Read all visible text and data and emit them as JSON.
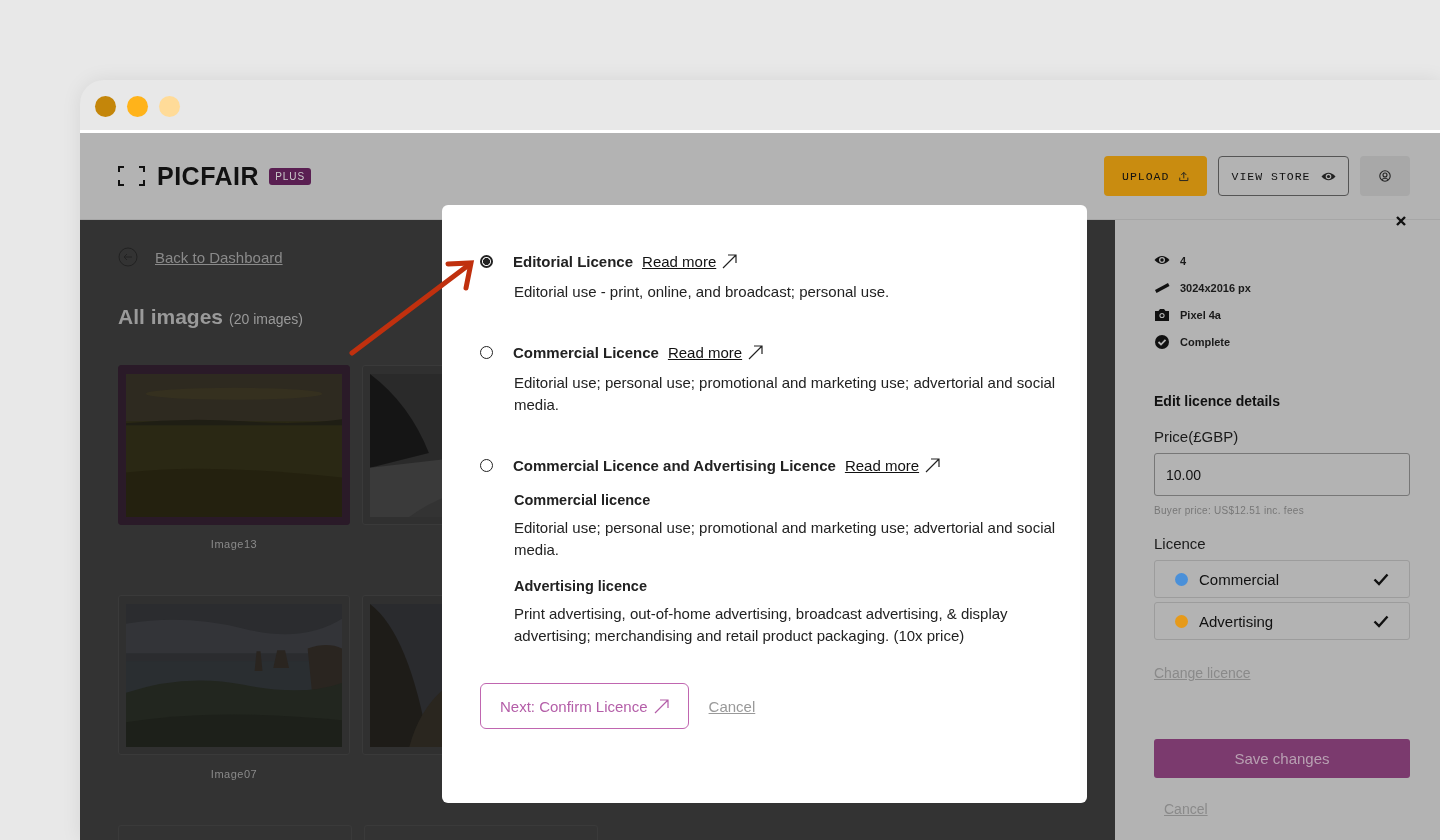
{
  "header": {
    "logo": "PICFAIR",
    "badge": "PLUS",
    "buttons": [
      {
        "kind": "upload",
        "label": "UPLOAD"
      },
      {
        "kind": "store",
        "label": "VIEW STORE"
      },
      {
        "kind": "account"
      }
    ]
  },
  "main": {
    "back_link": "Back to Dashboard",
    "title": "All images",
    "count": "(20 images)",
    "images": [
      {
        "label": "Image13",
        "selected": true
      },
      {
        "selected": false
      },
      {
        "label": "Image07",
        "selected": false
      },
      {
        "selected": false
      }
    ]
  },
  "panel": {
    "stats": [
      {
        "kind": "views",
        "text": "4"
      },
      {
        "kind": "size",
        "text": "3024x2016 px"
      },
      {
        "kind": "camera",
        "text": "Pixel 4a"
      },
      {
        "kind": "status",
        "text": "Complete"
      }
    ],
    "section_title": "Edit licence details",
    "price_label": "Price(£GBP)",
    "price_value": "10.00",
    "buyer_price": "Buyer price: US$12.51 inc. fees",
    "licence_label": "Licence",
    "licences": [
      {
        "name": "Commercial",
        "color": "#4a90d9",
        "checked": true
      },
      {
        "name": "Advertising",
        "color": "#e69a1a",
        "checked": true
      }
    ],
    "change_link": "Change licence",
    "save_button": "Save changes",
    "cancel_link": "Cancel"
  },
  "modal": {
    "options": [
      {
        "title": "Editorial Licence",
        "link": "Read more",
        "selected": true,
        "description": "Editorial use - print, online, and broadcast; personal use."
      },
      {
        "title": "Commercial Licence",
        "link": "Read more",
        "selected": false,
        "description": "Editorial use; personal use; promotional and marketing use; advertorial and social media."
      },
      {
        "title": "Commercial Licence and Advertising Licence",
        "link": "Read more",
        "selected": false,
        "sections": [
          {
            "heading": "Commercial licence",
            "text": "Editorial use; personal use; promotional and marketing use; advertorial and social media."
          },
          {
            "heading": "Advertising licence",
            "text": "Print advertising, out-of-home advertising, broadcast advertising, & display advertising; merchandising and retail product packaging. (10x price)"
          }
        ]
      }
    ],
    "next_button": "Next: Confirm Licence",
    "cancel_link": "Cancel"
  }
}
